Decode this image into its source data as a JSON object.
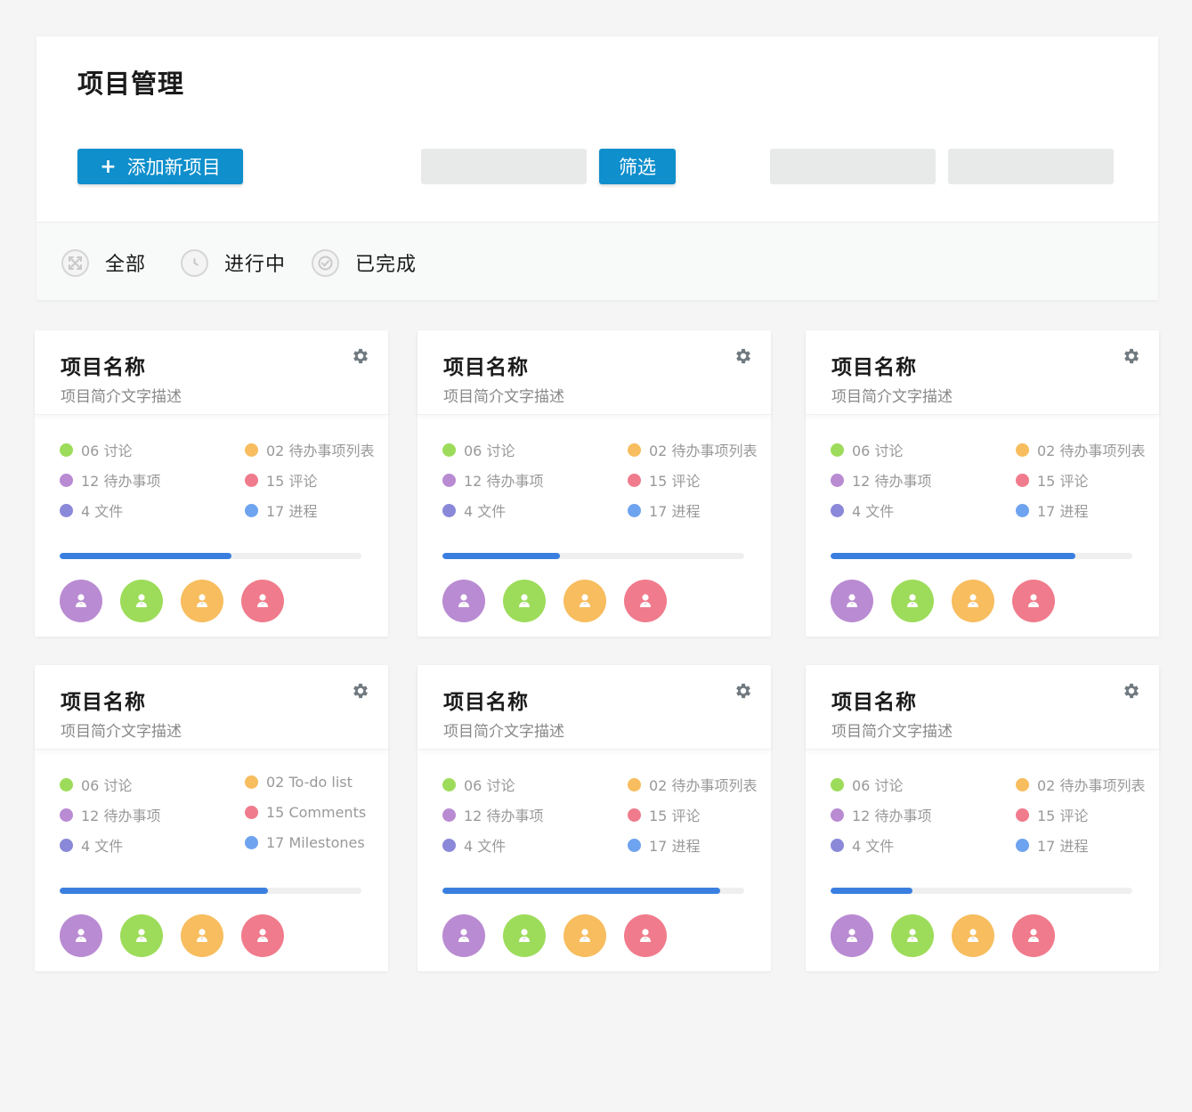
{
  "page_title": "项目管理",
  "toolbar": {
    "add_label": "添加新项目",
    "filter_label": "筛选",
    "search_1_value": "",
    "search_2_value": "",
    "search_3_value": ""
  },
  "tabs": [
    {
      "label": "全部",
      "icon": "expand-icon"
    },
    {
      "label": "进行中",
      "icon": "clock-icon"
    },
    {
      "label": "已完成",
      "icon": "check-circle-icon"
    }
  ],
  "colors": {
    "accent": "#0f8fcc",
    "progress": "#3a7fe0",
    "green": "#9ddc5a",
    "purple": "#b98bd2",
    "indigo": "#8a88d8",
    "orange": "#f7bd5e",
    "red": "#f07b8c",
    "blue": "#6ea3ef"
  },
  "cards": [
    {
      "title": "项目名称",
      "desc": "项目简介文字描述",
      "progress": 0.57,
      "stats": {
        "discussions": "06 讨论",
        "todos": "12 待办事项",
        "files": "4 文件",
        "todo_lists": "02 待办事项列表",
        "comments": "15 评论",
        "milestones": "17 进程"
      }
    },
    {
      "title": "项目名称",
      "desc": "项目简介文字描述",
      "progress": 0.39,
      "stats": {
        "discussions": "06 讨论",
        "todos": "12 待办事项",
        "files": "4 文件",
        "todo_lists": "02 待办事项列表",
        "comments": "15 评论",
        "milestones": "17 进程"
      }
    },
    {
      "title": "项目名称",
      "desc": "项目简介文字描述",
      "progress": 0.81,
      "stats": {
        "discussions": "06 讨论",
        "todos": "12 待办事项",
        "files": "4 文件",
        "todo_lists": "02 待办事项列表",
        "comments": "15 评论",
        "milestones": "17 进程"
      }
    },
    {
      "title": "项目名称",
      "desc": "项目简介文字描述",
      "progress": 0.69,
      "stats": {
        "discussions": "06 讨论",
        "todos": "12 待办事项",
        "files": "4 文件",
        "todo_lists": "02 To-do list",
        "comments": "15 Comments",
        "milestones": "17 Milestones"
      }
    },
    {
      "title": "项目名称",
      "desc": "项目简介文字描述",
      "progress": 0.92,
      "stats": {
        "discussions": "06 讨论",
        "todos": "12 待办事项",
        "files": "4 文件",
        "todo_lists": "02 待办事项列表",
        "comments": "15 评论",
        "milestones": "17 进程"
      }
    },
    {
      "title": "项目名称",
      "desc": "项目简介文字描述",
      "progress": 0.27,
      "stats": {
        "discussions": "06 讨论",
        "todos": "12 待办事项",
        "files": "4 文件",
        "todo_lists": "02 待办事项列表",
        "comments": "15 评论",
        "milestones": "17 进程"
      }
    }
  ]
}
